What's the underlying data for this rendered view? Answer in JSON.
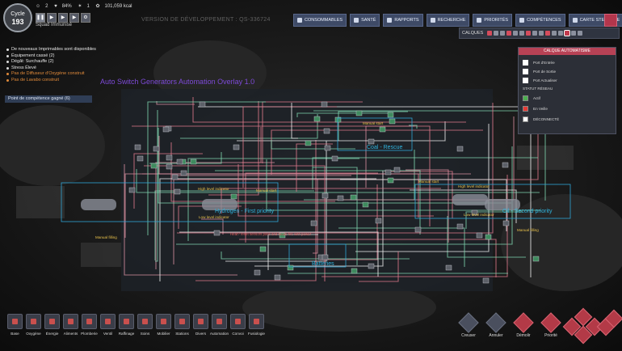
{
  "hud": {
    "cycle_label": "Cycle",
    "cycle_number": "193",
    "stats": {
      "duplicants": "2",
      "stress": "84%",
      "rations": "1",
      "calories": "101,059 kcal"
    },
    "squad_label": "Squad Immunisé",
    "version": "VERSION DE DÉVELOPPEMENT : QS-336724"
  },
  "alerts": [
    {
      "text": "De nouveaux Imprimables sont disponibles",
      "warn": false
    },
    {
      "text": "Équipement cassé (2)",
      "warn": false
    },
    {
      "text": "Dégât: Surchauffe (2)",
      "warn": false
    },
    {
      "text": "Stress Élevé",
      "warn": false
    },
    {
      "text": "Pas de Diffuseur d'Oxygène construit",
      "warn": true
    },
    {
      "text": "Pas de Lavabo construit",
      "warn": true
    }
  ],
  "skill_point": "Point de compétence gagné (6)",
  "top_menu": [
    {
      "label": "CONSOMMABLES",
      "icon": "fork-knife-icon"
    },
    {
      "label": "SANTÉ",
      "icon": "heart-icon"
    },
    {
      "label": "RAPPORTS",
      "icon": "chart-icon"
    },
    {
      "label": "RECHERCHE",
      "icon": "research-icon"
    },
    {
      "label": "PRIORITÉS",
      "icon": "priority-icon"
    },
    {
      "label": "COMPÉTENCES",
      "icon": "wrench-icon"
    },
    {
      "label": "CARTE STELLAIRE",
      "icon": "rocket-icon"
    }
  ],
  "overlay_bar": {
    "label": "CALQUES"
  },
  "legend": {
    "title": "CALQUE AUTOMATISME",
    "ports": [
      {
        "label": "Port d'Entrée",
        "icon": "input-port-icon"
      },
      {
        "label": "Port de Sortie",
        "icon": "output-port-icon"
      },
      {
        "label": "Port Actualiser",
        "icon": "reset-port-icon"
      }
    ],
    "network_title": "STATUT RÉSEAU",
    "statuses": [
      {
        "label": "Actif",
        "color": "#4caf50"
      },
      {
        "label": "En Veille",
        "color": "#e53935"
      },
      {
        "label": "DÉCONNECTÉ",
        "color": "#ffffff"
      }
    ]
  },
  "map": {
    "title": "Auto Switch Generators Automation Overlay 1.0",
    "coal_label": "Coal - Rescue",
    "hydrogen_label": "Hydrogen - First priority",
    "oil_label": "Oil - Second priority",
    "batteries_label": "Batteries",
    "manual_start": "Manual start",
    "high_level": "High level indicator",
    "low_level": "Low level indicator",
    "manual_filling": "Manual filling",
    "red_note": "Heat? reset sensors pass and Mode fire with power"
  },
  "toolbar": [
    {
      "label": "Base",
      "icon": "base-icon"
    },
    {
      "label": "Oxygène",
      "icon": "oxygen-icon"
    },
    {
      "label": "Énergie",
      "icon": "power-icon"
    },
    {
      "label": "Aliments",
      "icon": "food-icon"
    },
    {
      "label": "Plomberie",
      "icon": "plumbing-icon"
    },
    {
      "label": "Ventil",
      "icon": "ventilation-icon"
    },
    {
      "label": "Raffinage",
      "icon": "refinement-icon"
    },
    {
      "label": "Soins",
      "icon": "medical-icon"
    },
    {
      "label": "Mobilier",
      "icon": "furniture-icon"
    },
    {
      "label": "Stations",
      "icon": "stations-icon"
    },
    {
      "label": "Divers",
      "icon": "utilities-icon"
    },
    {
      "label": "Automation",
      "icon": "automation-icon"
    },
    {
      "label": "Convoi",
      "icon": "conveyor-icon"
    },
    {
      "label": "Fusiologie",
      "icon": "rocketry-icon"
    }
  ],
  "actions": [
    {
      "label": "Creuser",
      "icon": "dig-icon",
      "active": false
    },
    {
      "label": "Annuler",
      "icon": "cancel-icon",
      "active": false
    },
    {
      "label": "Démolir",
      "icon": "deconstruct-icon",
      "active": true
    },
    {
      "label": "Priorité",
      "icon": "priority-icon",
      "active": true
    }
  ]
}
